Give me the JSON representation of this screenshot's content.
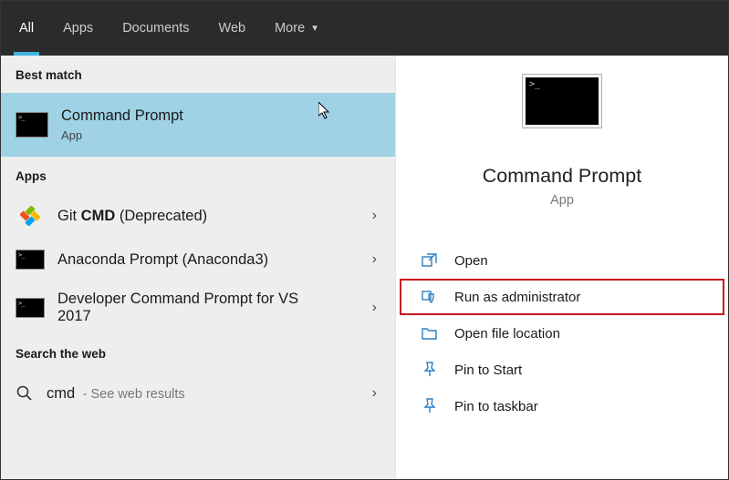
{
  "header": {
    "tabs": {
      "all": "All",
      "apps": "Apps",
      "documents": "Documents",
      "web": "Web",
      "more": "More"
    }
  },
  "sections": {
    "best_match": "Best match",
    "apps": "Apps",
    "search_web": "Search the web"
  },
  "best_match": {
    "title": "Command Prompt",
    "subtitle": "App"
  },
  "apps_list": {
    "git": {
      "prefix": "Git ",
      "bold": "CMD",
      "suffix": " (Deprecated)"
    },
    "anaconda": "Anaconda Prompt (Anaconda3)",
    "vs2017": "Developer Command Prompt for VS 2017"
  },
  "web_search": {
    "query": "cmd",
    "hint": "- See web results"
  },
  "preview": {
    "title": "Command Prompt",
    "subtitle": "App"
  },
  "actions": {
    "open": "Open",
    "run_admin": "Run as administrator",
    "open_location": "Open file location",
    "pin_start": "Pin to Start",
    "pin_taskbar": "Pin to taskbar"
  }
}
